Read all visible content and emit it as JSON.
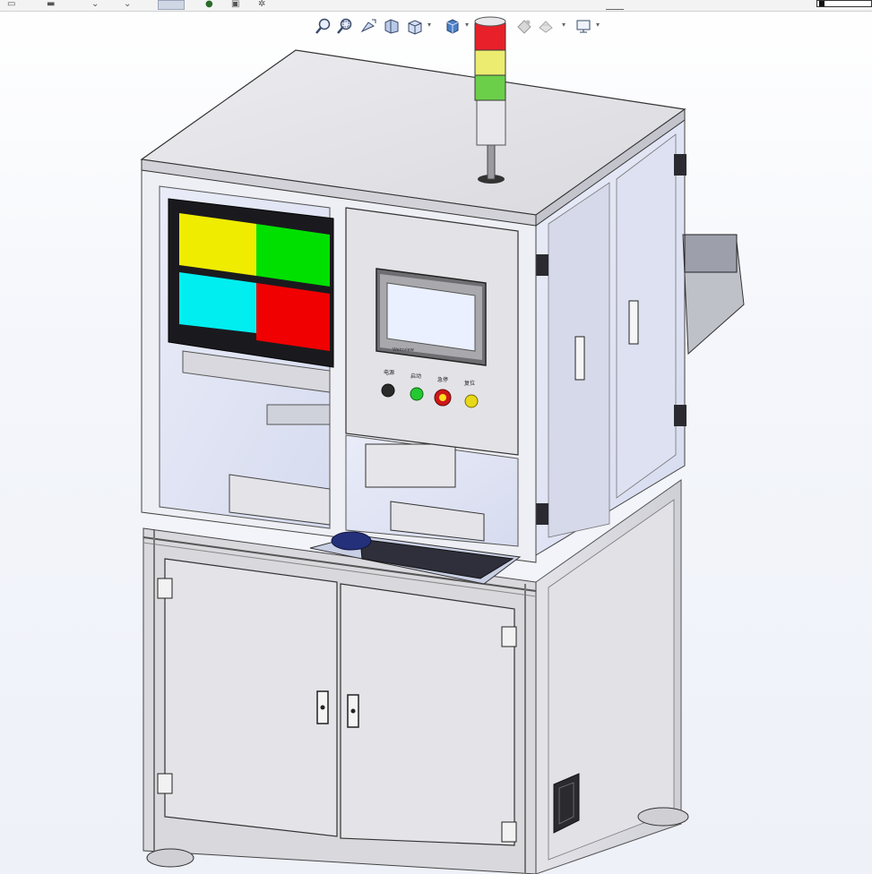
{
  "app": {
    "accent": "#2f6fd6",
    "background": "#f1f3f8"
  },
  "top_toolbar": {
    "icons": [
      "file-icon",
      "printer-icon",
      "undo-icon",
      "redo-icon",
      "select-icon",
      "rebuild-icon",
      "options-icon",
      "settings-icon"
    ],
    "right_field": ""
  },
  "heads_up_toolbar": {
    "tools": [
      "zoom-to-fit-icon",
      "zoom-to-area-icon",
      "previous-view-icon",
      "section-view-icon",
      "view-orientation-icon",
      "display-style-icon",
      "hide-show-items-icon",
      "edit-appearance-icon",
      "apply-scene-icon",
      "view-settings-icon"
    ]
  },
  "model": {
    "name": "",
    "monitor_quadrant_colors": [
      "#efec00",
      "#00e000",
      "#00eef0",
      "#f00000"
    ],
    "stack_light_colors": [
      "#e8202a",
      "#ecec70",
      "#6ccf4a"
    ],
    "panel_button_colors": [
      "#222222",
      "#24c832",
      "#cc1818",
      "#e8d81a"
    ],
    "panel_labels": [
      "电源",
      "启动",
      "急停",
      "复位"
    ],
    "hmi_brand": "Weinview"
  }
}
